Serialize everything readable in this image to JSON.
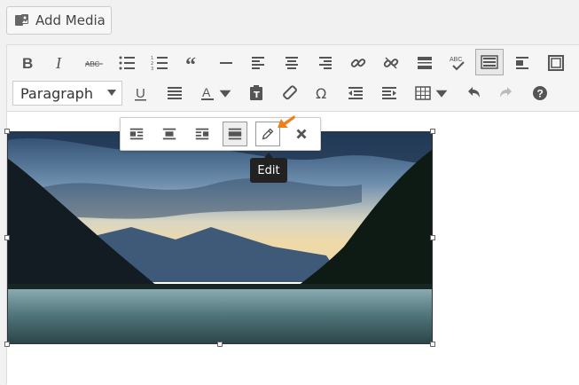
{
  "media": {
    "add_label": "Add Media"
  },
  "toolbar": {
    "format_select": "Paragraph",
    "abc_label": "ABC"
  },
  "image_toolbar": {
    "tooltip": "Edit"
  },
  "colors": {
    "accent": "#f07e19",
    "editor_bg": "#ffffff",
    "toolbar_bg": "#f5f5f5"
  }
}
